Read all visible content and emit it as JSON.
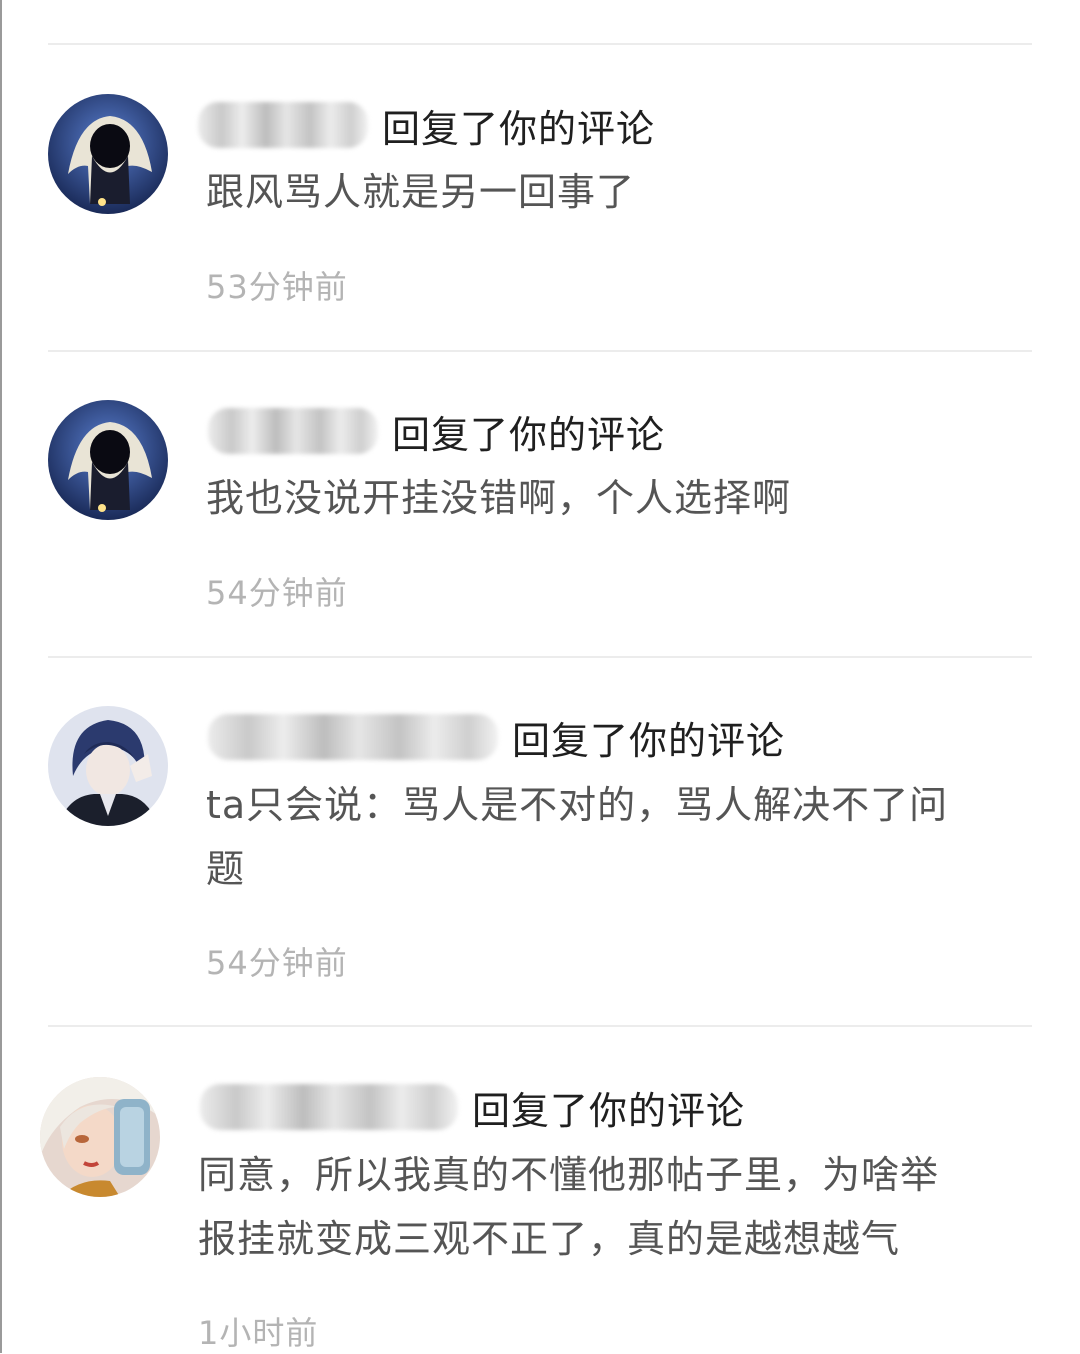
{
  "comments": [
    {
      "action": "回复了你的评论",
      "content": "跟风骂人就是另一回事了",
      "time": "53分钟前",
      "avatar_icon": "hooded-figure-avatar"
    },
    {
      "action": "回复了你的评论",
      "content": "我也没说开挂没错啊，个人选择啊",
      "time": "54分钟前",
      "avatar_icon": "hooded-figure-avatar"
    },
    {
      "action": "回复了你的评论",
      "content": "ta只会说：骂人是不对的，骂人解决不了问\n题",
      "time": "54分钟前",
      "avatar_icon": "anime-boy-avatar"
    },
    {
      "action": "回复了你的评论",
      "content": "同意，所以我真的不懂他那帖子里，为啥举\n报挂就变成三观不正了，真的是越想越气",
      "time": "1小时前",
      "avatar_icon": "anime-girl-avatar"
    }
  ]
}
